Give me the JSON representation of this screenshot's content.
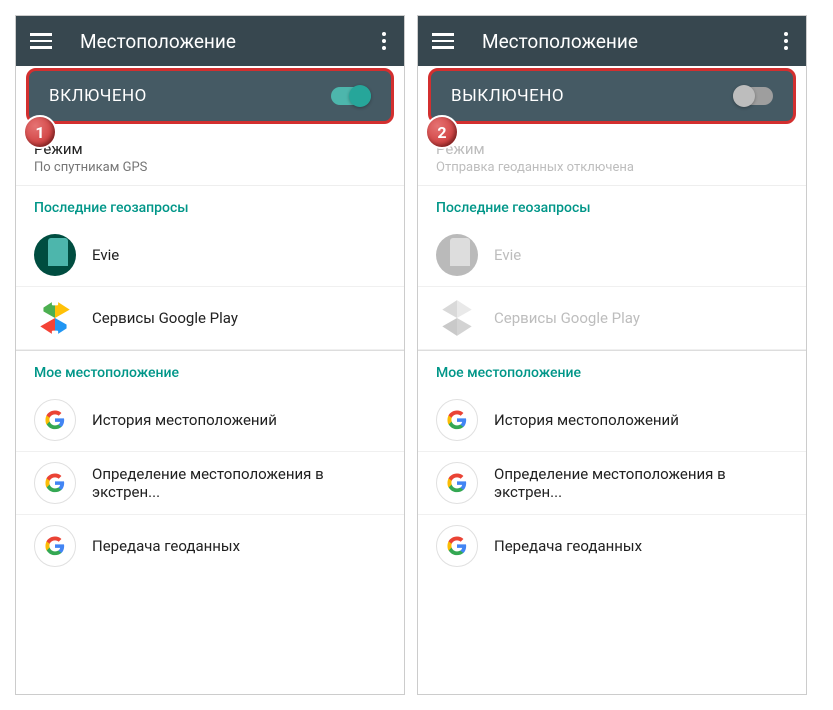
{
  "screens": [
    {
      "badge": "1",
      "title": "Местоположение",
      "toggle_label": "ВКЛЮЧЕНО",
      "toggle_on": true,
      "mode_title": "Режим",
      "mode_sub": "По спутникам GPS",
      "mode_dimmed": false,
      "recent_header": "Последние геозапросы",
      "recent": [
        {
          "label": "Evie"
        },
        {
          "label": "Сервисы Google Play"
        }
      ],
      "recent_dimmed": false,
      "my_header": "Мое местоположение",
      "my_items": [
        {
          "label": "История местоположений"
        },
        {
          "label": "Определение местоположения в экстрен..."
        },
        {
          "label": "Передача геоданных"
        }
      ]
    },
    {
      "badge": "2",
      "title": "Местоположение",
      "toggle_label": "ВЫКЛЮЧЕНО",
      "toggle_on": false,
      "mode_title": "Режим",
      "mode_sub": "Отправка геоданных отключена",
      "mode_dimmed": true,
      "recent_header": "Последние геозапросы",
      "recent": [
        {
          "label": "Evie"
        },
        {
          "label": "Сервисы Google Play"
        }
      ],
      "recent_dimmed": true,
      "my_header": "Мое местоположение",
      "my_items": [
        {
          "label": "История местоположений"
        },
        {
          "label": "Определение местоположения в экстрен..."
        },
        {
          "label": "Передача геоданных"
        }
      ]
    }
  ]
}
